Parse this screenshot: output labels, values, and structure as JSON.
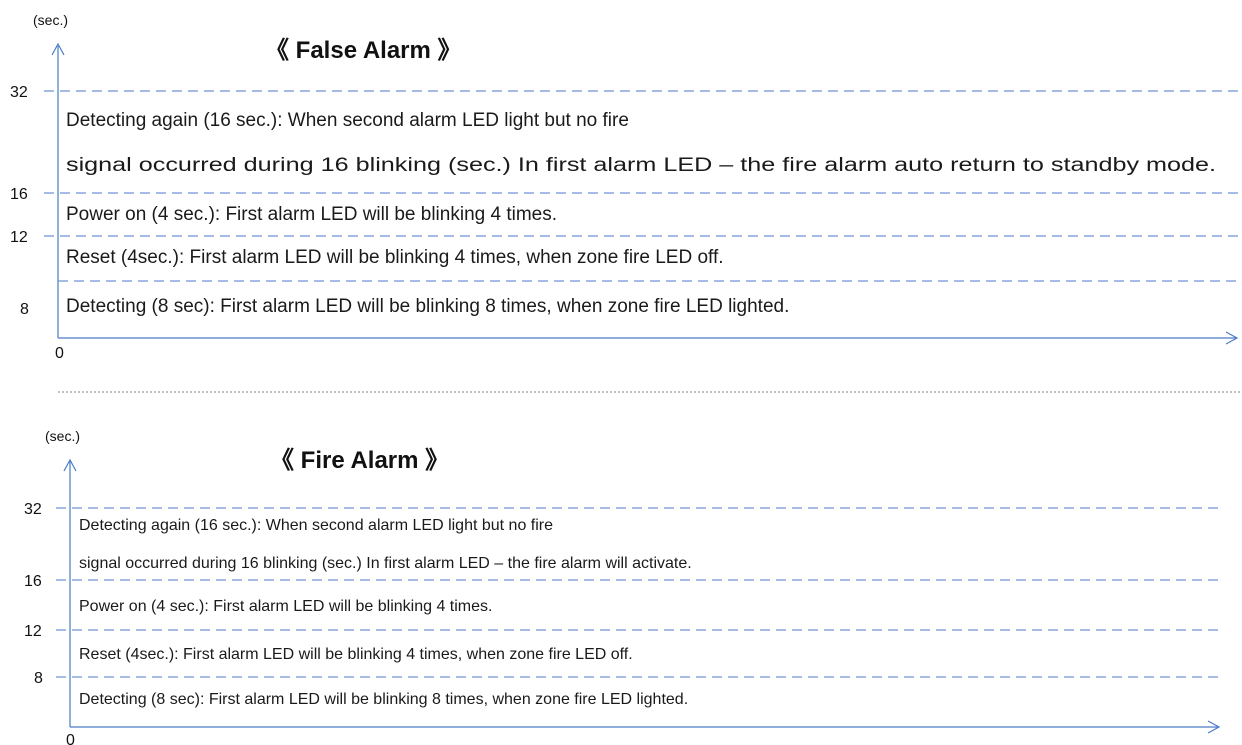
{
  "colors": {
    "axis": "#4a7bc8",
    "dash": "#6f95d4",
    "separator": "#9a9a9a",
    "text": "#1a1a1a"
  },
  "false_alarm": {
    "unit_label": "(sec.)",
    "title": "《 False Alarm 》",
    "origin_label": "0",
    "ticks": [
      "32",
      "16",
      "12",
      "8"
    ],
    "rows": [
      "Detecting again (16 sec.): When second alarm LED light but no fire",
      "signal occurred during 16 blinking (sec.)  In first alarm LED – the fire alarm auto return to standby mode.",
      "Power on (4 sec.): First alarm LED will be blinking 4 times.",
      "Reset (4sec.): First alarm LED will be blinking 4 times, when zone fire LED off.",
      "Detecting (8 sec): First alarm LED will be blinking 8 times, when zone fire LED lighted."
    ]
  },
  "fire_alarm": {
    "unit_label": "(sec.)",
    "title": "《 Fire Alarm 》",
    "origin_label": "0",
    "ticks": [
      "32",
      "16",
      "12",
      "8"
    ],
    "rows": [
      "Detecting again (16 sec.): When second alarm LED light but no fire",
      "signal occurred during 16 blinking (sec.)  In first alarm LED – the fire alarm will activate.",
      "Power on (4 sec.): First alarm LED will be blinking 4 times.",
      "Reset (4sec.): First alarm LED will be blinking 4 times, when zone fire LED off.",
      "Detecting (8 sec): First alarm LED will be blinking 8 times, when zone fire LED lighted."
    ]
  }
}
